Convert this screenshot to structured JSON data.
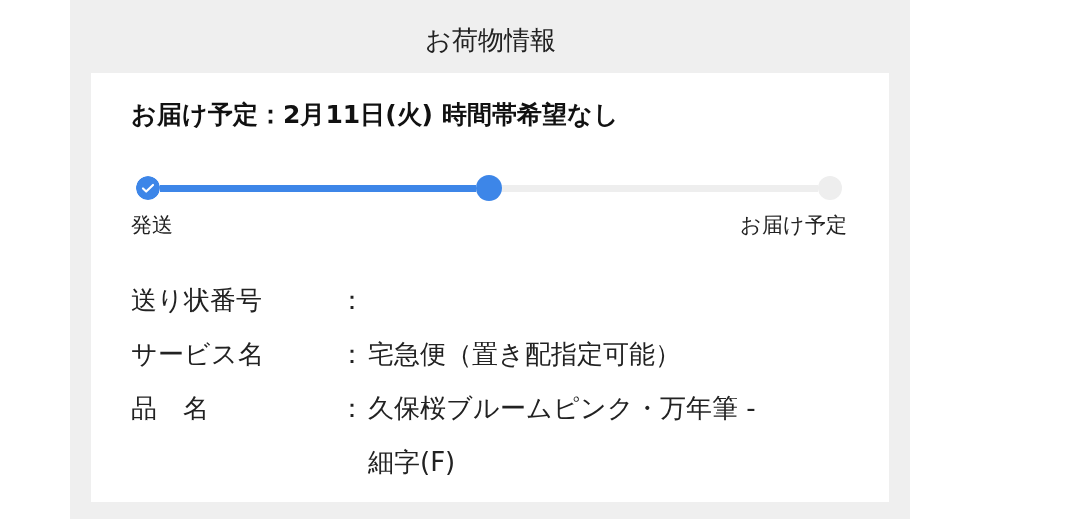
{
  "header": {
    "title": "お荷物情報"
  },
  "delivery": {
    "heading": "お届け予定：2月11日(火) 時間帯希望なし"
  },
  "progress": {
    "steps": [
      {
        "label": "発送",
        "completed": true,
        "current": false
      },
      {
        "completed": false,
        "current": true
      },
      {
        "label": "お届け予定",
        "completed": false,
        "current": false
      }
    ]
  },
  "details": [
    {
      "label": "送り状番号",
      "colon": "："
    },
    {
      "label": "サービス名",
      "colon": "：",
      "value": "宅急便（置き配指定可能）"
    },
    {
      "label": "品　名",
      "colon": "：",
      "value": "久保桜ブルームピンク・万年筆 - 細字(F)"
    }
  ]
}
